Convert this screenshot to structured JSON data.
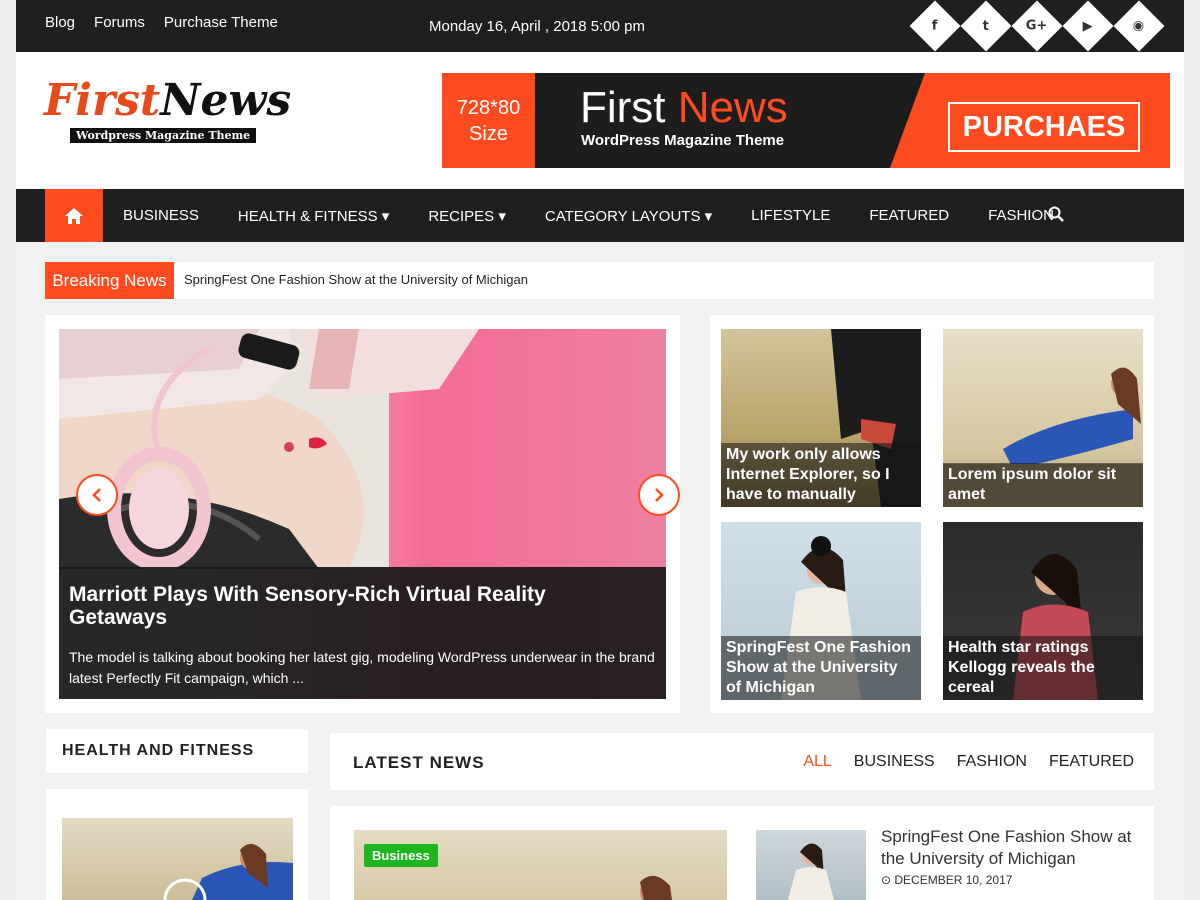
{
  "topbar": {
    "links": [
      "Blog",
      "Forums",
      "Purchase Theme"
    ],
    "date": "Monday 16, April , 2018 5:00 pm",
    "socials": [
      {
        "icon": "facebook-icon",
        "glyph": "f"
      },
      {
        "icon": "twitter-icon",
        "glyph": "t"
      },
      {
        "icon": "google-plus-icon",
        "glyph": "G+"
      },
      {
        "icon": "youtube-icon",
        "glyph": "▶"
      },
      {
        "icon": "rss-icon",
        "glyph": "◉"
      }
    ]
  },
  "logo": {
    "first": "First",
    "news": "News",
    "tagline": "Wordpress Magazine Theme"
  },
  "banner": {
    "size_line1": "728*80",
    "size_line2": "Size",
    "title_first": "First",
    "title_news": "News",
    "subtitle": "WordPress Magazine Theme",
    "button": "PURCHAES"
  },
  "nav": {
    "items": [
      "BUSINESS",
      "HEALTH & FITNESS ▾",
      "RECIPES ▾",
      "CATEGORY LAYOUTS ▾",
      "LIFESTYLE",
      "FEATURED",
      "FASHION"
    ]
  },
  "breaking": {
    "label": "Breaking News",
    "text": "SpringFest One Fashion Show at the University of Michigan"
  },
  "slider": {
    "title": "Marriott Plays With Sensory-Rich Virtual Reality Getaways",
    "desc": "The model is talking about booking her latest gig, modeling WordPress underwear in the brand latest Perfectly Fit campaign, which ..."
  },
  "grid": [
    {
      "caption": "My work only allows Internet Explorer, so I have to manually"
    },
    {
      "caption": "Lorem ipsum dolor sit amet"
    },
    {
      "caption": "SpringFest One Fashion Show at the University of Michigan"
    },
    {
      "caption": "Health star ratings Kellogg reveals the cereal"
    }
  ],
  "sidebar": {
    "widget_title": "HEALTH AND FITNESS"
  },
  "latest": {
    "title": "LATEST NEWS",
    "tabs": [
      "ALL",
      "BUSINESS",
      "FASHION",
      "FEATURED"
    ],
    "badge": "Business",
    "side_title": "SpringFest One Fashion Show at the University of Michigan",
    "side_date": "⊙ DECEMBER 10, 2017"
  },
  "colors": {
    "accent": "#ff4b1f",
    "dark": "#1f1f1f",
    "badge_green": "#1fb51f"
  }
}
